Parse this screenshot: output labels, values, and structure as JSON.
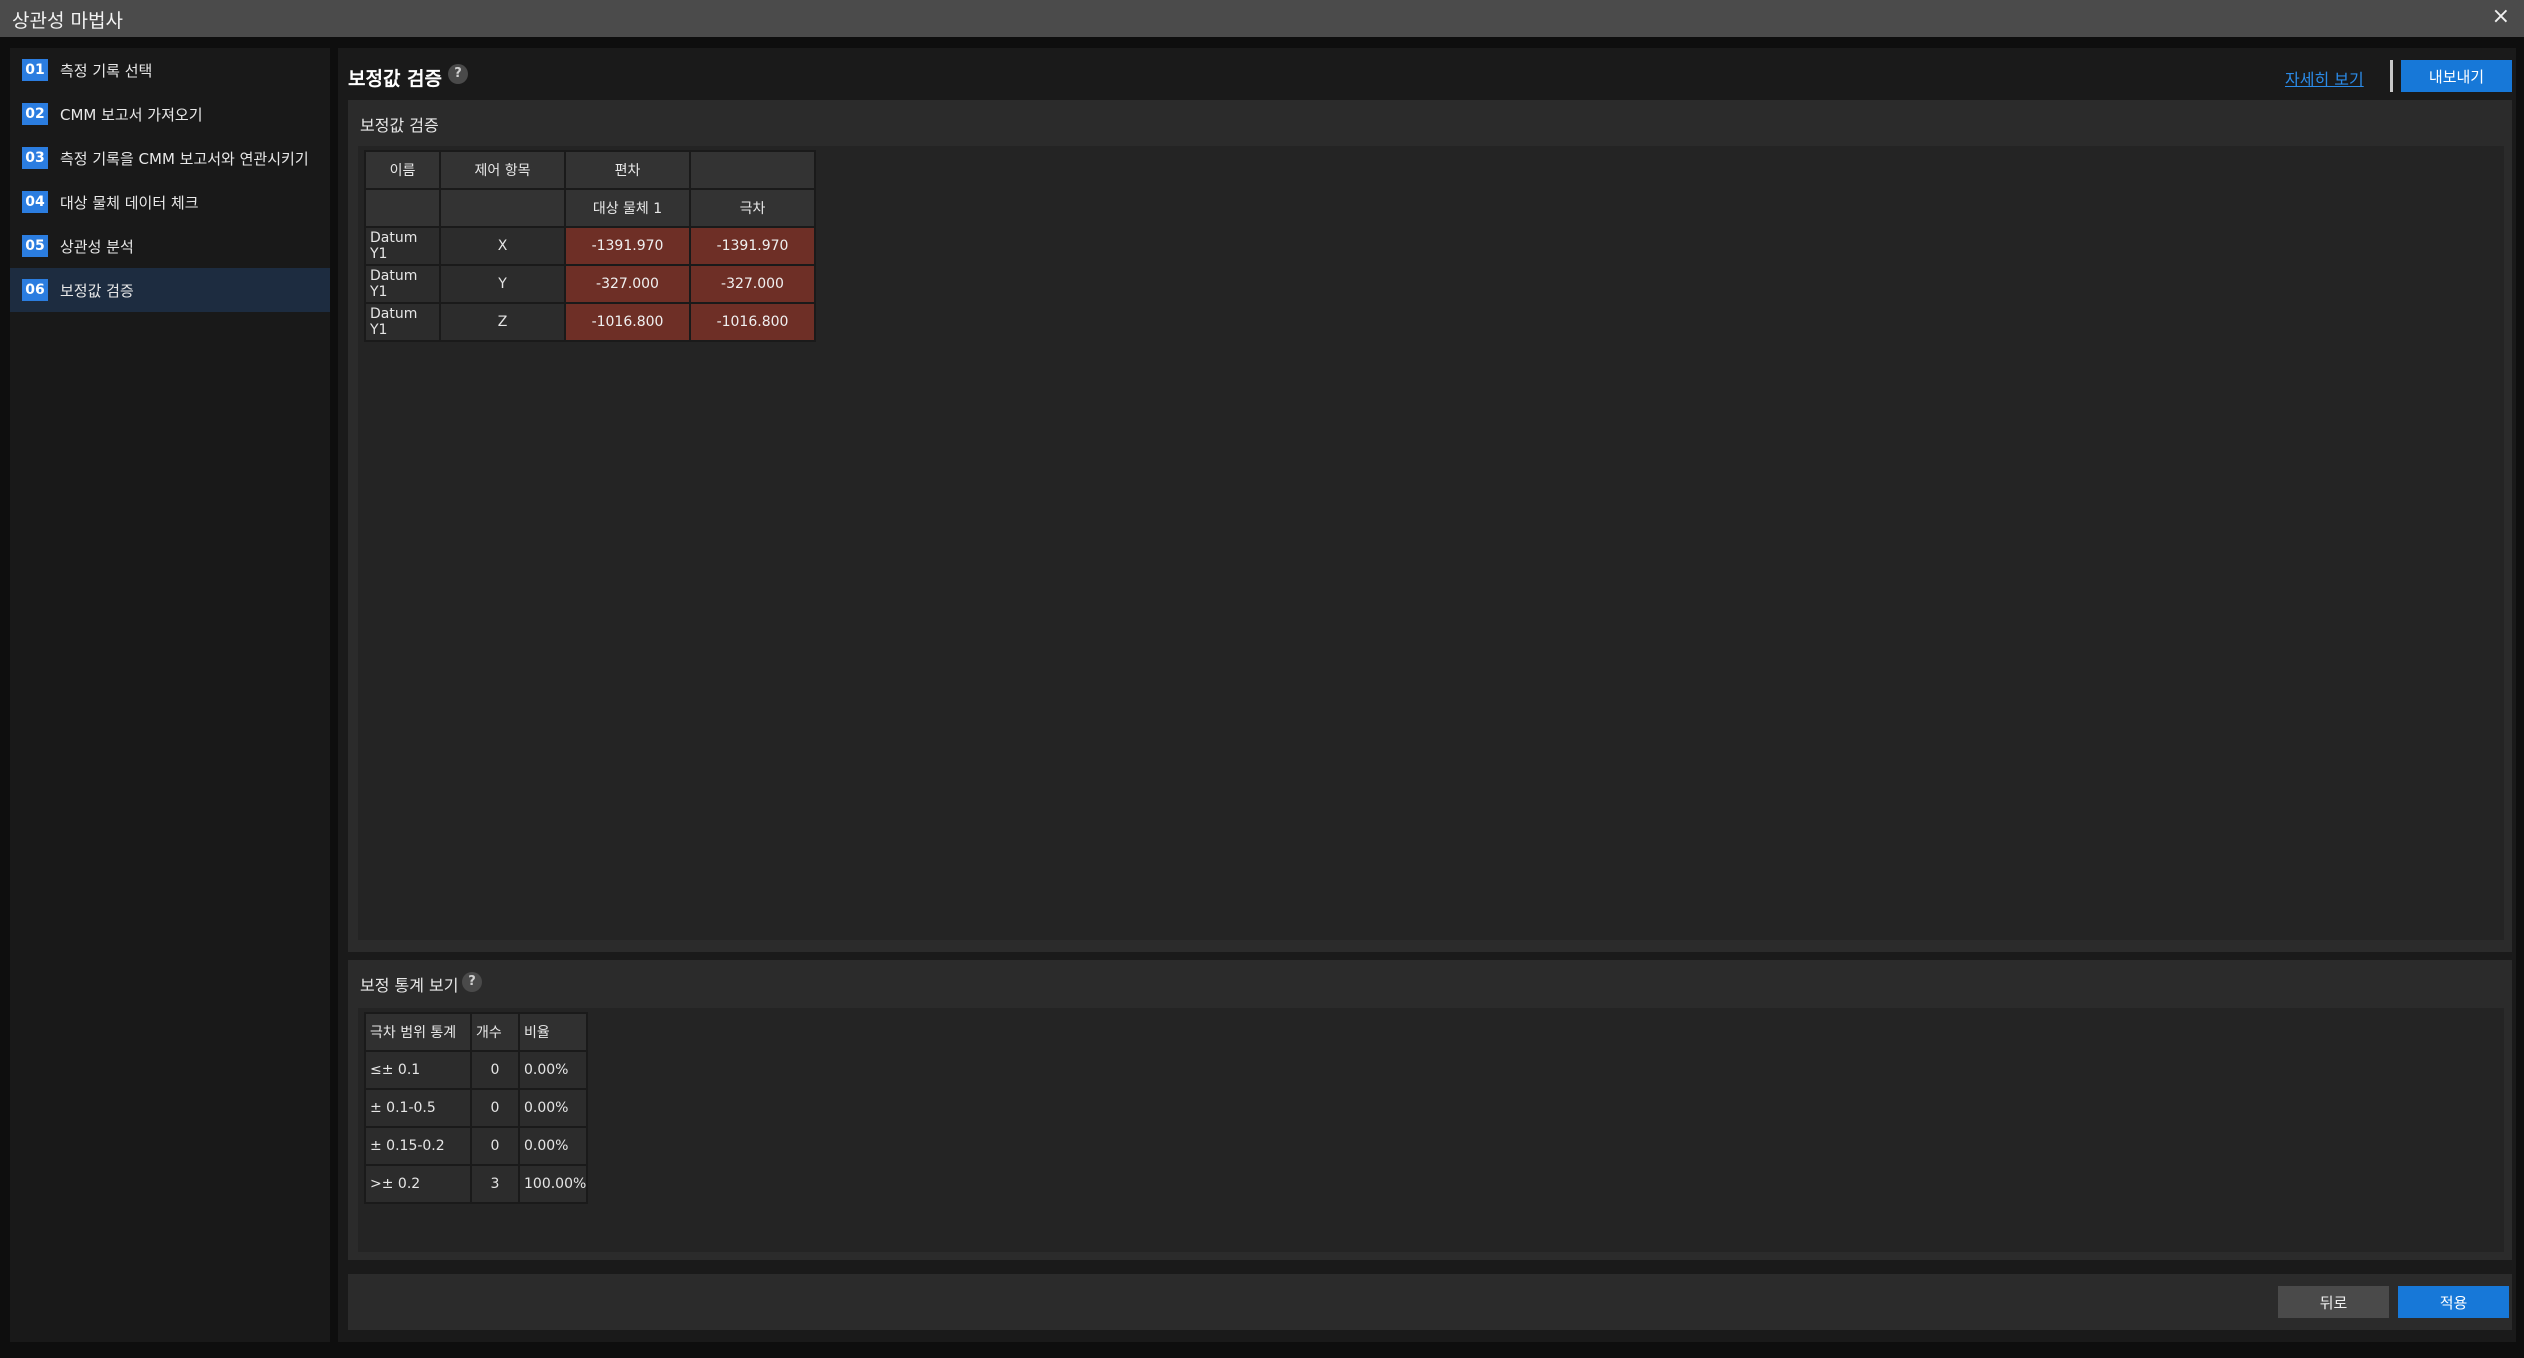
{
  "window": {
    "title": "상관성 마법사",
    "close_icon": "×"
  },
  "steps": [
    {
      "num": "01",
      "label": "측정 기록 선택"
    },
    {
      "num": "02",
      "label": "CMM 보고서 가져오기"
    },
    {
      "num": "03",
      "label": "측정 기록을 CMM 보고서와 연관시키기"
    },
    {
      "num": "04",
      "label": "대상 물체 데이터 체크"
    },
    {
      "num": "05",
      "label": "상관성 분석"
    },
    {
      "num": "06",
      "label": "보정값 검증"
    }
  ],
  "active_step": "06",
  "header": {
    "title": "보정값 검증",
    "help": "?",
    "details_link": "자세히 보기",
    "export_label": "내보내기"
  },
  "verify_panel": {
    "title": "보정값 검증",
    "columns": {
      "name": "이름",
      "control": "제어 항목",
      "deviation": "편차",
      "object1": "대상 물체 1",
      "tolerance": "극차"
    },
    "rows": [
      {
        "name": "Datum Y1",
        "control": "X",
        "object1": "-1391.970",
        "tolerance": "-1391.970"
      },
      {
        "name": "Datum Y1",
        "control": "Y",
        "object1": "-327.000",
        "tolerance": "-327.000"
      },
      {
        "name": "Datum Y1",
        "control": "Z",
        "object1": "-1016.800",
        "tolerance": "-1016.800"
      }
    ]
  },
  "stats_panel": {
    "title": "보정 통계 보기",
    "help": "?",
    "columns": {
      "range": "극차 범위 통계",
      "count": "개수",
      "ratio": "비율"
    },
    "rows": [
      {
        "range": "≤± 0.1",
        "count": "0",
        "ratio": "0.00%"
      },
      {
        "range": "± 0.1-0.5",
        "count": "0",
        "ratio": "0.00%"
      },
      {
        "range": "± 0.15-0.2",
        "count": "0",
        "ratio": "0.00%"
      },
      {
        "range": ">± 0.2",
        "count": "3",
        "ratio": "100.00%"
      }
    ]
  },
  "footer": {
    "back_label": "뒤로",
    "apply_label": "적용"
  },
  "colors": {
    "accent": "#1778d8",
    "deviation_cell": "#6e2f26",
    "active_step_bg": "#1d2c40"
  }
}
